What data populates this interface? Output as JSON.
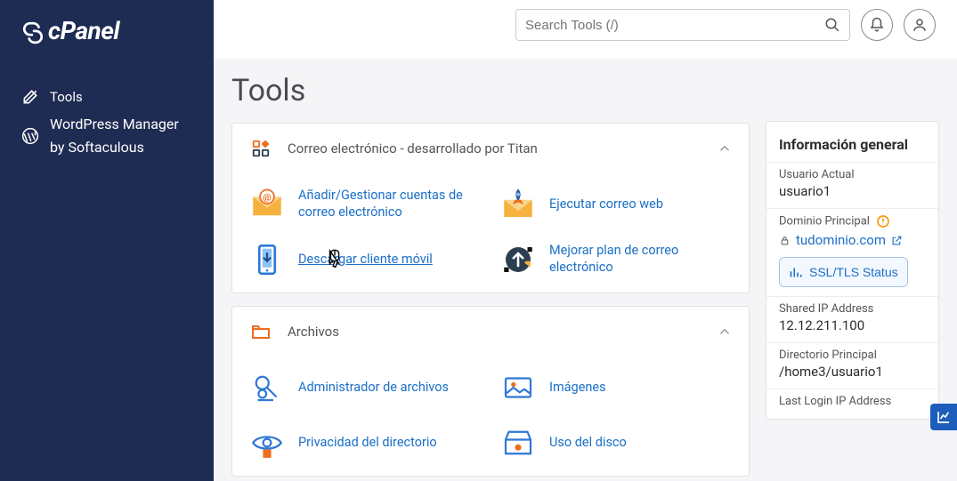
{
  "brand": "cPanel",
  "sidebar": {
    "items": [
      "Tools",
      "WordPress Manager by Softaculous"
    ]
  },
  "search": {
    "placeholder": "Search Tools (/)"
  },
  "page": {
    "title": "Tools"
  },
  "groups": [
    {
      "title": "Correo electrónico - desarrollado por Titan",
      "items": [
        "Añadir/Gestionar cuentas de correo electrónico",
        "Ejecutar correo web",
        "Descargar cliente móvil",
        "Mejorar plan de correo electrónico"
      ]
    },
    {
      "title": "Archivos",
      "items": [
        "Administrador de archivos",
        "Imágenes",
        "Privacidad del directorio",
        "Uso del disco"
      ]
    }
  ],
  "info": {
    "title": "Información general",
    "sections": {
      "user": {
        "label": "Usuario Actual",
        "value": "usuario1"
      },
      "domain": {
        "label": "Dominio Principal",
        "value": "tudominio.com"
      },
      "ssl_button": "SSL/TLS Status",
      "ip": {
        "label": "Shared IP Address",
        "value": "12.12.211.100"
      },
      "homedir": {
        "label": "Directorio Principal",
        "value": "/home3/usuario1"
      },
      "lastlogin": {
        "label": "Last Login IP Address"
      }
    }
  }
}
